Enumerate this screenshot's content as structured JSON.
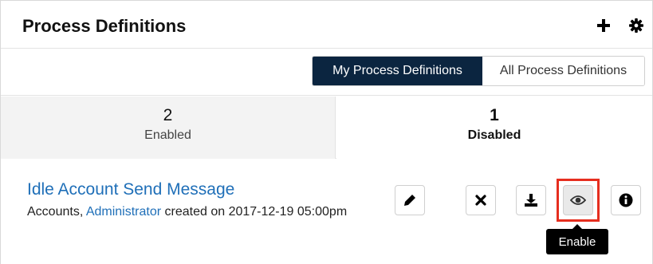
{
  "dashlet": {
    "title": "Process Definitions",
    "icons": {
      "add": "plus-icon",
      "settings": "gear-icon"
    }
  },
  "filter": {
    "options": [
      "My Process Definitions",
      "All Process Definitions"
    ],
    "selected": "My Process Definitions"
  },
  "tabs": [
    {
      "count": "2",
      "label": "Enabled",
      "active": false
    },
    {
      "count": "1",
      "label": "Disabled",
      "active": true
    }
  ],
  "record": {
    "title": "Idle Account Send Message",
    "module": "Accounts,",
    "user": "Administrator",
    "created": "created on 2017-12-19 05:00pm"
  },
  "actions": [
    {
      "name": "edit",
      "icon": "pencil-icon"
    },
    {
      "name": "delete",
      "icon": "close-icon"
    },
    {
      "name": "export",
      "icon": "download-icon"
    },
    {
      "name": "enable",
      "icon": "eye-icon"
    },
    {
      "name": "info",
      "icon": "info-icon"
    }
  ],
  "tooltip": "Enable",
  "colors": {
    "accent_dark": "#0b2540",
    "link": "#1f6fb8",
    "highlight": "#e62e1f"
  }
}
